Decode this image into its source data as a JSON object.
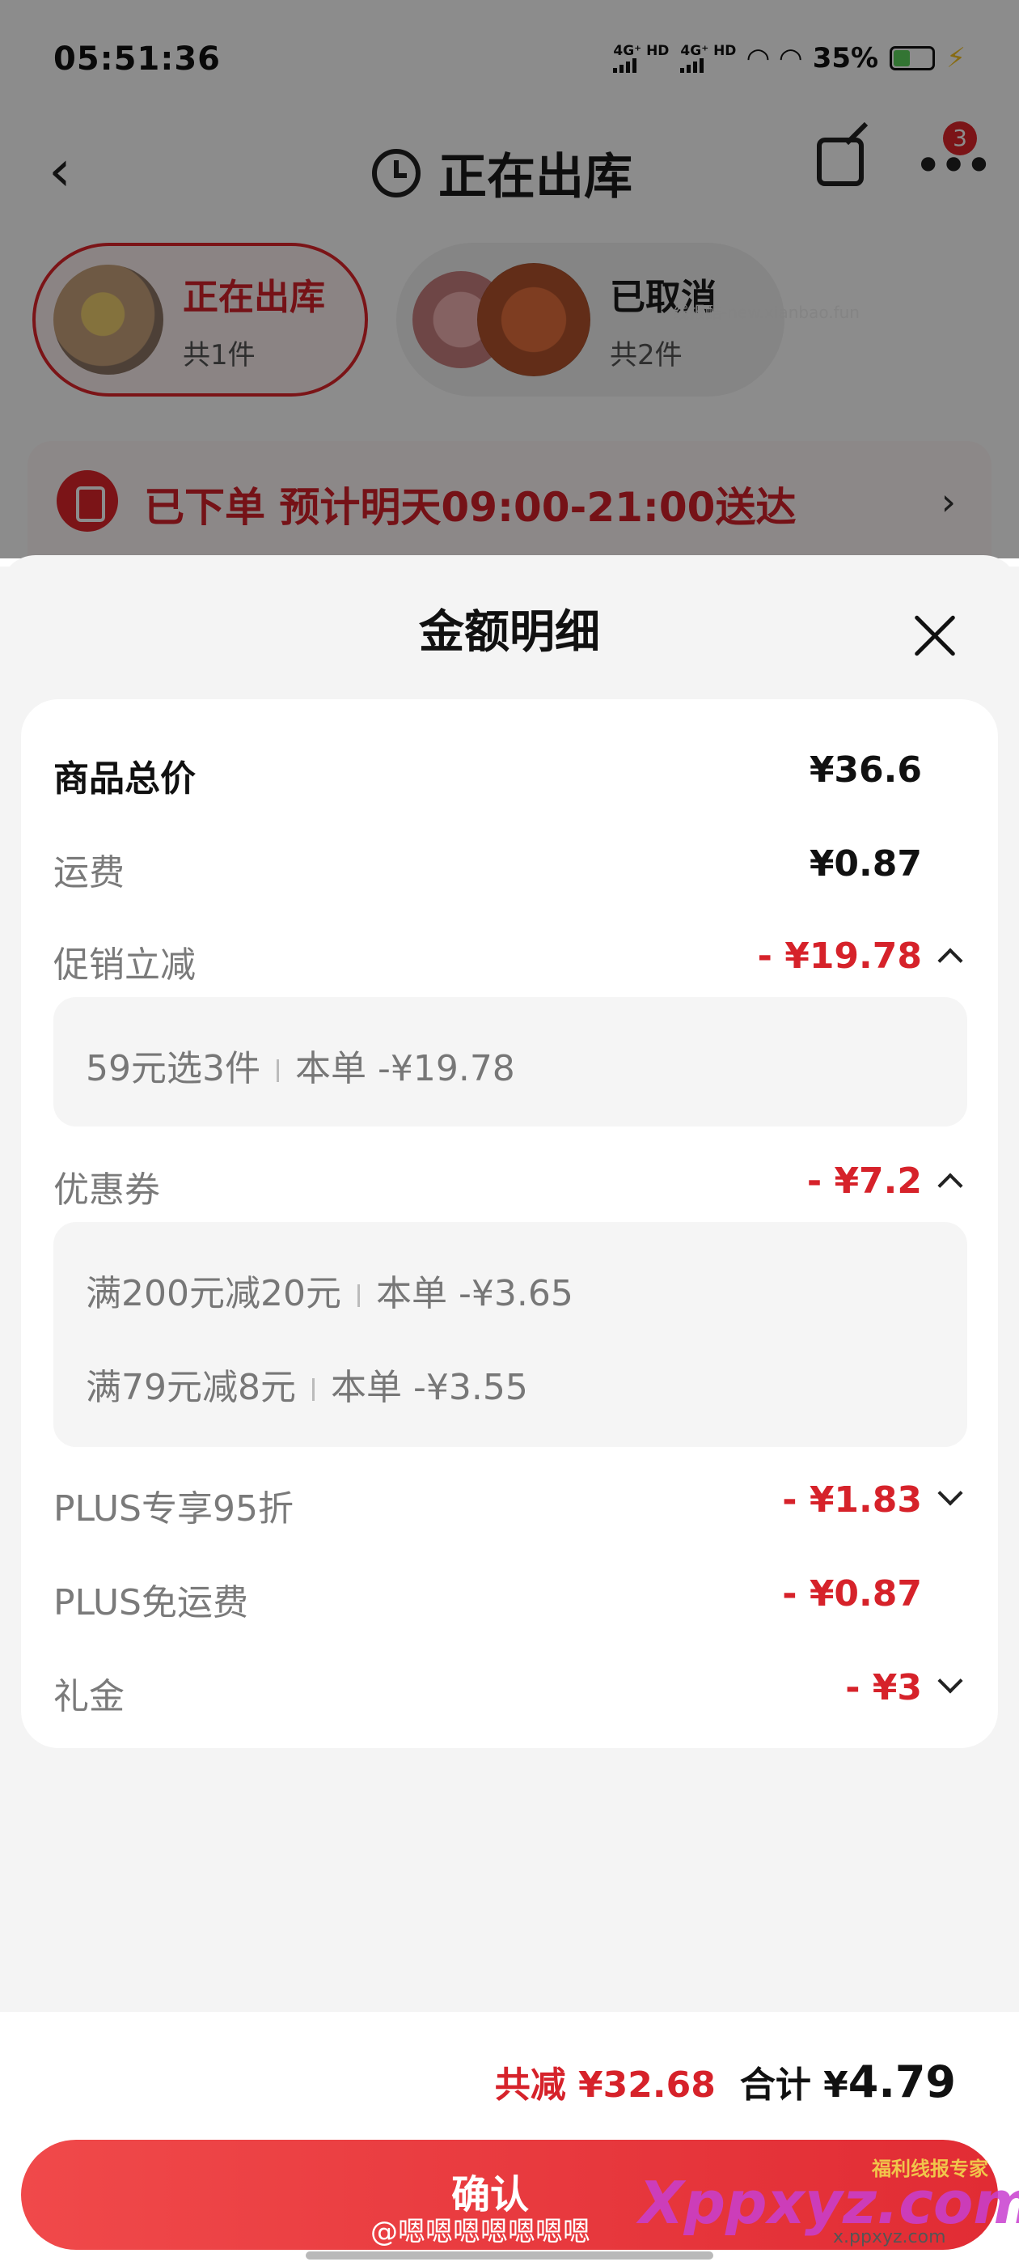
{
  "status_bar": {
    "time": "05:51:36",
    "net1": "4G⁺ HD",
    "net2": "4G⁺ HD",
    "battery": "35%"
  },
  "nav": {
    "title": "正在出库",
    "badge": "3"
  },
  "packages": [
    {
      "name": "正在出库",
      "count": "共1件"
    },
    {
      "name": "已取消",
      "count": "共2件"
    }
  ],
  "watermark_text": "线报酷-new.xianbao.fun",
  "order_status": {
    "text": "已下单  预计明天09:00-21:00送达"
  },
  "sheet": {
    "title": "金额明细",
    "rows": [
      {
        "label": "商品总价",
        "value": "¥36.6"
      },
      {
        "label": "运费",
        "value": "¥0.87"
      },
      {
        "label": "促销立减",
        "value": "- ¥19.78"
      },
      {
        "label": "优惠券",
        "value": "- ¥7.2"
      },
      {
        "label": "PLUS专享95折",
        "value": "- ¥1.83"
      },
      {
        "label": "PLUS免运费",
        "value": "- ¥0.87"
      },
      {
        "label": "礼金",
        "value": "- ¥3"
      }
    ],
    "promo_details": [
      {
        "name": "59元选3件",
        "amount": "本单 -¥19.78"
      }
    ],
    "coupon_details": [
      {
        "name": "满200元减20元",
        "amount": "本单 -¥3.65"
      },
      {
        "name": "满79元减8元",
        "amount": "本单 -¥3.55"
      }
    ]
  },
  "footer": {
    "saved": "共减 ¥32.68",
    "total_label": "合计 ¥",
    "total_value": "4.79",
    "confirm": "确认",
    "credit": "@嗯嗯嗯嗯嗯嗯嗯"
  },
  "brand": {
    "main": "Xppxyz.com",
    "small": "福利线报专家",
    "sub": "x.ppxyz.com"
  },
  "colors": {
    "accent": "#d6222a",
    "button": "#e12c34"
  }
}
